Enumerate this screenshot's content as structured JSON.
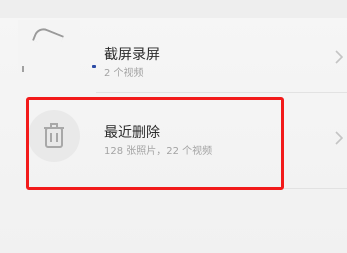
{
  "albums": [
    {
      "title": "截屏录屏",
      "subtitle": "2 个视频",
      "icon": "screenshot-thumbnail"
    },
    {
      "title": "最近删除",
      "subtitle": "128 张照片，22 个视频",
      "icon": "trash-icon"
    }
  ],
  "colors": {
    "highlight": "#f21a1a",
    "title": "#2b2b2b",
    "subtitle": "#a3a3a3"
  }
}
